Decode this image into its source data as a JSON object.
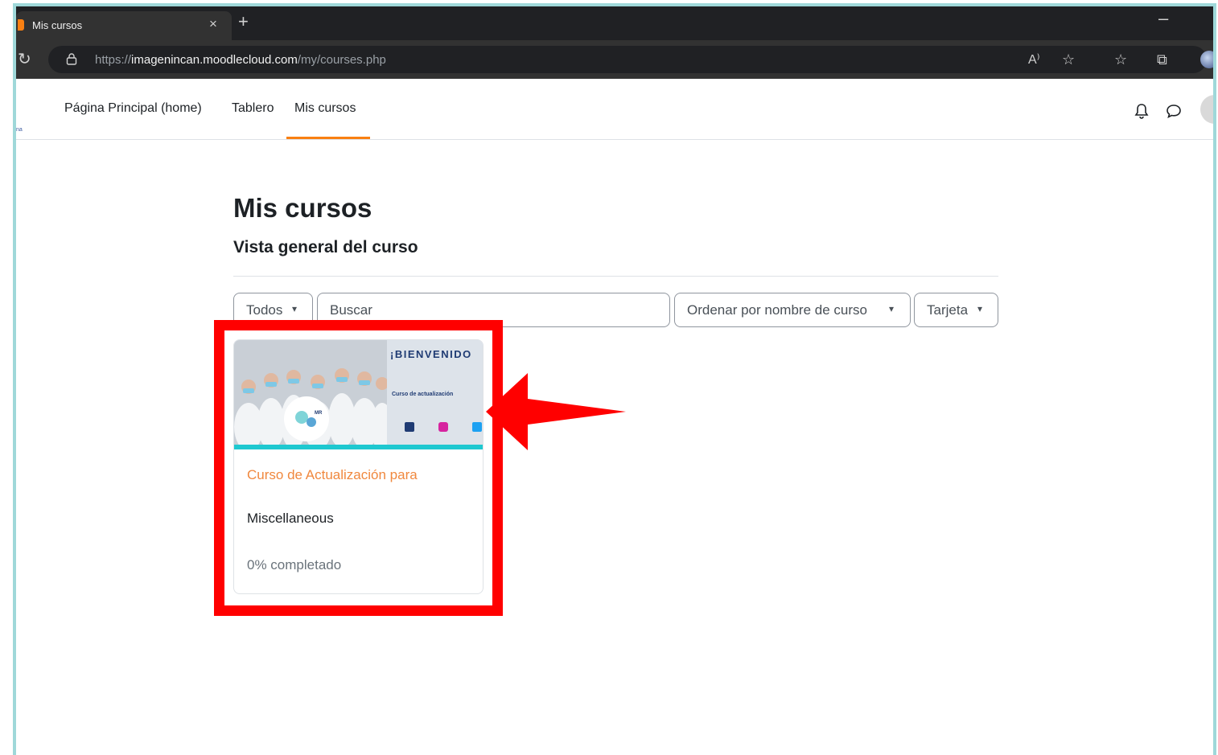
{
  "browser": {
    "tab_title": "Mis cursos",
    "tab_close": "×",
    "new_tab": "+",
    "minimize": "–",
    "url_prefix": "https://",
    "url_domain": "imagenincan.moodlecloud.com",
    "url_path": "/my/courses.php"
  },
  "nav": {
    "logo_fragment": "na",
    "items": [
      {
        "label": "Página Principal (home)"
      },
      {
        "label": "Tablero"
      },
      {
        "label": "Mis cursos",
        "active": true
      }
    ]
  },
  "page": {
    "title": "Mis cursos",
    "section_title": "Vista general del curso"
  },
  "filters": {
    "grouping": "Todos",
    "search_placeholder": "Buscar",
    "sort": "Ordenar por nombre de curso",
    "view": "Tarjeta"
  },
  "course_card": {
    "image_banner": {
      "heading": "¡BIENVENIDO",
      "subtitle": "Curso de actualización",
      "logo_text": "MR"
    },
    "name": "Curso de Actualización para",
    "category": "Miscellaneous",
    "progress": "0% completado",
    "progress_value": 0
  },
  "colors": {
    "accent": "#f98012",
    "course_link": "#f0883e",
    "highlight": "#ff0000",
    "frame": "#9fd8d9",
    "card_stripe": "#1ec8d0"
  }
}
